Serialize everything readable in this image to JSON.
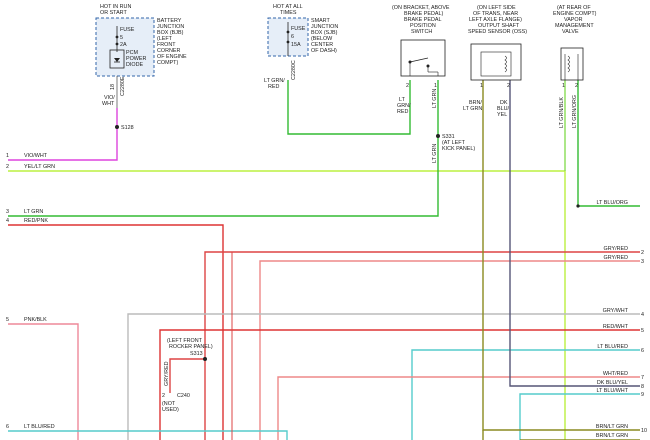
{
  "components": {
    "bjb": {
      "hot_lines": [
        "HOT IN RUN",
        "OR START"
      ],
      "fuse": [
        "FUSE",
        "5",
        "2A"
      ],
      "diode": [
        "PCM",
        "POWER",
        "DIODE"
      ],
      "desc": [
        "BATTERY",
        "JUNCTION",
        "BOX (BJB)",
        "(LEFT",
        "FRONT",
        "CORNER",
        "OF ENGINE",
        "COMPT)"
      ]
    },
    "sjb": {
      "hot_lines": [
        "HOT AT ALL",
        "TIMES"
      ],
      "fuse": [
        "FUSE",
        "6",
        "15A"
      ],
      "desc": [
        "SMART",
        "JUNCTION",
        "BOX (SJB)",
        "(BELOW",
        "CENTER",
        "OF DASH)"
      ]
    },
    "bpp": {
      "desc": [
        "(ON BRACKET, ABOVE",
        "BRAKE PEDAL)",
        "BRAKE PEDAL",
        "POSITION",
        "SWITCH"
      ],
      "pins": [
        "2",
        "1"
      ],
      "wire_left": [
        "LT",
        "GRN/",
        "RED"
      ],
      "wire_right": [
        "LT",
        "GRN"
      ]
    },
    "oss": {
      "desc": [
        "(ON LEFT SIDE",
        "OF TRANS, NEAR",
        "LEFT AXLE FLANGE)",
        "OUTPUT SHAFT",
        "SPEED SENSOR (OSS)"
      ],
      "pins": [
        "1",
        "2"
      ],
      "wire_left": [
        "BRN/",
        "LT GRN"
      ],
      "wire_right": [
        "DK",
        "BLU/",
        "YEL"
      ]
    },
    "vmv": {
      "desc": [
        "(AT REAR OF",
        "ENGINE COMPT)",
        "VAPOR",
        "MANAGEMENT",
        "VALVE"
      ],
      "pins": [
        "1",
        "2"
      ],
      "wire_left": "LT GRN/BLK",
      "wire_right": "LT GRN/ORG"
    },
    "c2280e": "C2280E",
    "c2280c": "C2280C",
    "bjb_wire_pin": "18",
    "bjb_wire_color": [
      "VIO/",
      "WHT"
    ],
    "sjb_wire_color": [
      "LT GRN/",
      "RED"
    ],
    "splice_s128": "S128",
    "splice_s331": [
      "S331",
      "(AT LEFT",
      "KICK PANEL)"
    ],
    "s331_wire": [
      "LT",
      "GRN"
    ],
    "splice_s313": [
      "(LEFT FRONT",
      "ROCKER PANEL)",
      "S313"
    ],
    "s313_wire": "GRY/RED",
    "c240_pin": "2",
    "c240": "C240",
    "not_used": [
      "(NOT",
      "USED)"
    ]
  },
  "left_wires": [
    {
      "num": "1",
      "label": "VIO/WHT",
      "color": "#dd44dd"
    },
    {
      "num": "2",
      "label": "YEL/LT GRN",
      "color": "#bbf040"
    },
    {
      "num": "3",
      "label": "LT GRN",
      "color": "#33bb33"
    },
    {
      "num": "4",
      "label": "RED/PNK",
      "color": "#dd3333"
    },
    {
      "num": "5",
      "label": "PNK/BLK",
      "color": "#ee8899"
    },
    {
      "num": "6",
      "label": "LT BLU/RED",
      "color": "#55cccc"
    }
  ],
  "right_wires": [
    {
      "num": "",
      "label": "LT BLU/ORG",
      "color": "#55cccc"
    },
    {
      "num": "2",
      "label": "GRY/RED",
      "color": "#dd4444"
    },
    {
      "num": "3",
      "label": "GRY/RED",
      "color": "#dd4444"
    },
    {
      "num": "4",
      "label": "GRY/WHT",
      "color": "#aaaaaa"
    },
    {
      "num": "5",
      "label": "RED/WHT",
      "color": "#dd3333"
    },
    {
      "num": "6",
      "label": "LT BLU/RED",
      "color": "#55cccc"
    },
    {
      "num": "7",
      "label": "WHT/RED",
      "color": "#ee8888"
    },
    {
      "num": "8",
      "label": "DK BLU/YEL",
      "color": "#555577"
    },
    {
      "num": "9",
      "label": "LT BLU/WHT",
      "color": "#55cccc"
    },
    {
      "num": "10",
      "label": "BRN/LT GRN",
      "color": "#8a8a20"
    },
    {
      "num": "",
      "label": "BRN/LT GRN",
      "color": "#8a8a20"
    }
  ],
  "colors": {
    "vio_wht": "#dd44dd",
    "lt_grn": "#33bb33",
    "yel_ltgrn": "#bbf040",
    "brn_ltgrn": "#8a8a20",
    "dk_blu_yel": "#555577",
    "lt_blu": "#55cccc"
  }
}
